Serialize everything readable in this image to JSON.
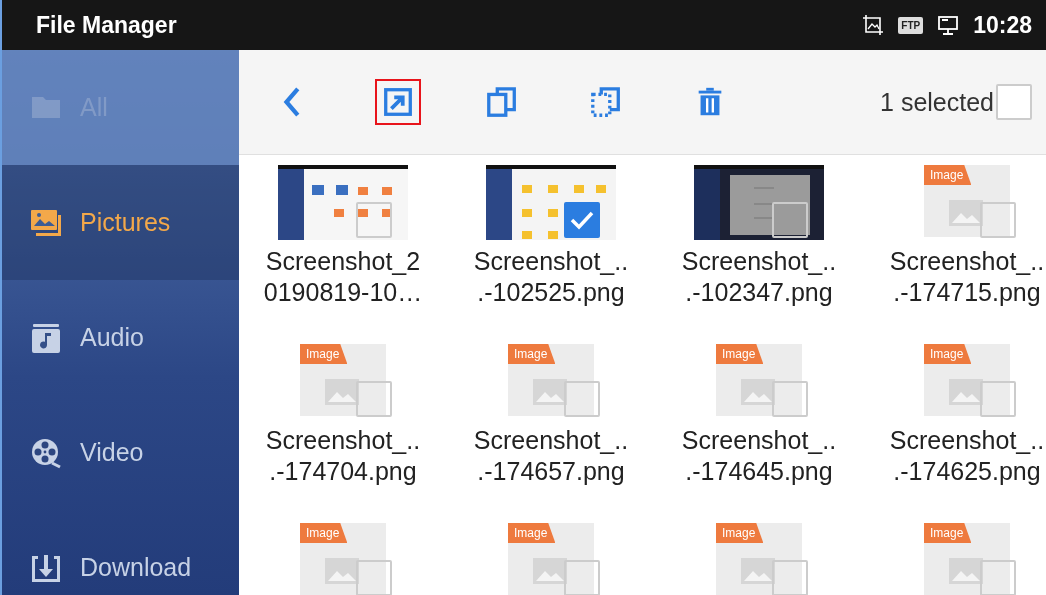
{
  "status_bar": {
    "title": "File Manager",
    "ftp": "FTP",
    "time": "10:28"
  },
  "sidebar": {
    "items": [
      {
        "kind": "folder",
        "label": "All",
        "selected": false,
        "disabled": true
      },
      {
        "kind": "pictures",
        "label": "Pictures",
        "selected": true,
        "disabled": false
      },
      {
        "kind": "audio",
        "label": "Audio",
        "selected": false,
        "disabled": false
      },
      {
        "kind": "video",
        "label": "Video",
        "selected": false,
        "disabled": false
      },
      {
        "kind": "download",
        "label": "Download",
        "selected": false,
        "disabled": false
      }
    ]
  },
  "toolbar": {
    "tools": [
      {
        "kind": "back",
        "highlighted": false
      },
      {
        "kind": "move",
        "highlighted": true
      },
      {
        "kind": "copy",
        "highlighted": false
      },
      {
        "kind": "select",
        "highlighted": false
      },
      {
        "kind": "delete",
        "highlighted": false
      }
    ],
    "selection_text": "1 selected",
    "select_all_checked": false
  },
  "files": [
    {
      "kind": "screenshot",
      "checked": false,
      "name_lines": [
        "Screenshot_2",
        "0190819-10…"
      ]
    },
    {
      "kind": "screenshot2",
      "checked": true,
      "name_lines": [
        "Screenshot_..",
        ".-102525.png"
      ]
    },
    {
      "kind": "screenshot3",
      "checked": false,
      "name_lines": [
        "Screenshot_..",
        ".-102347.png"
      ]
    },
    {
      "kind": "image",
      "badge": "Image",
      "checked": false,
      "name_lines": [
        "Screenshot_..",
        ".-174715.png"
      ]
    },
    {
      "kind": "image",
      "badge": "Image",
      "checked": false,
      "name_lines": [
        "Screenshot_..",
        ".-174704.png"
      ]
    },
    {
      "kind": "image",
      "badge": "Image",
      "checked": false,
      "name_lines": [
        "Screenshot_..",
        ".-174657.png"
      ]
    },
    {
      "kind": "image",
      "badge": "Image",
      "checked": false,
      "name_lines": [
        "Screenshot_..",
        ".-174645.png"
      ]
    },
    {
      "kind": "image",
      "badge": "Image",
      "checked": false,
      "name_lines": [
        "Screenshot_..",
        ".-174625.png"
      ]
    },
    {
      "kind": "image",
      "badge": "Image",
      "checked": false
    },
    {
      "kind": "image",
      "badge": "Image",
      "checked": false
    },
    {
      "kind": "image",
      "badge": "Image",
      "checked": false
    },
    {
      "kind": "image",
      "badge": "Image",
      "checked": false
    }
  ]
}
